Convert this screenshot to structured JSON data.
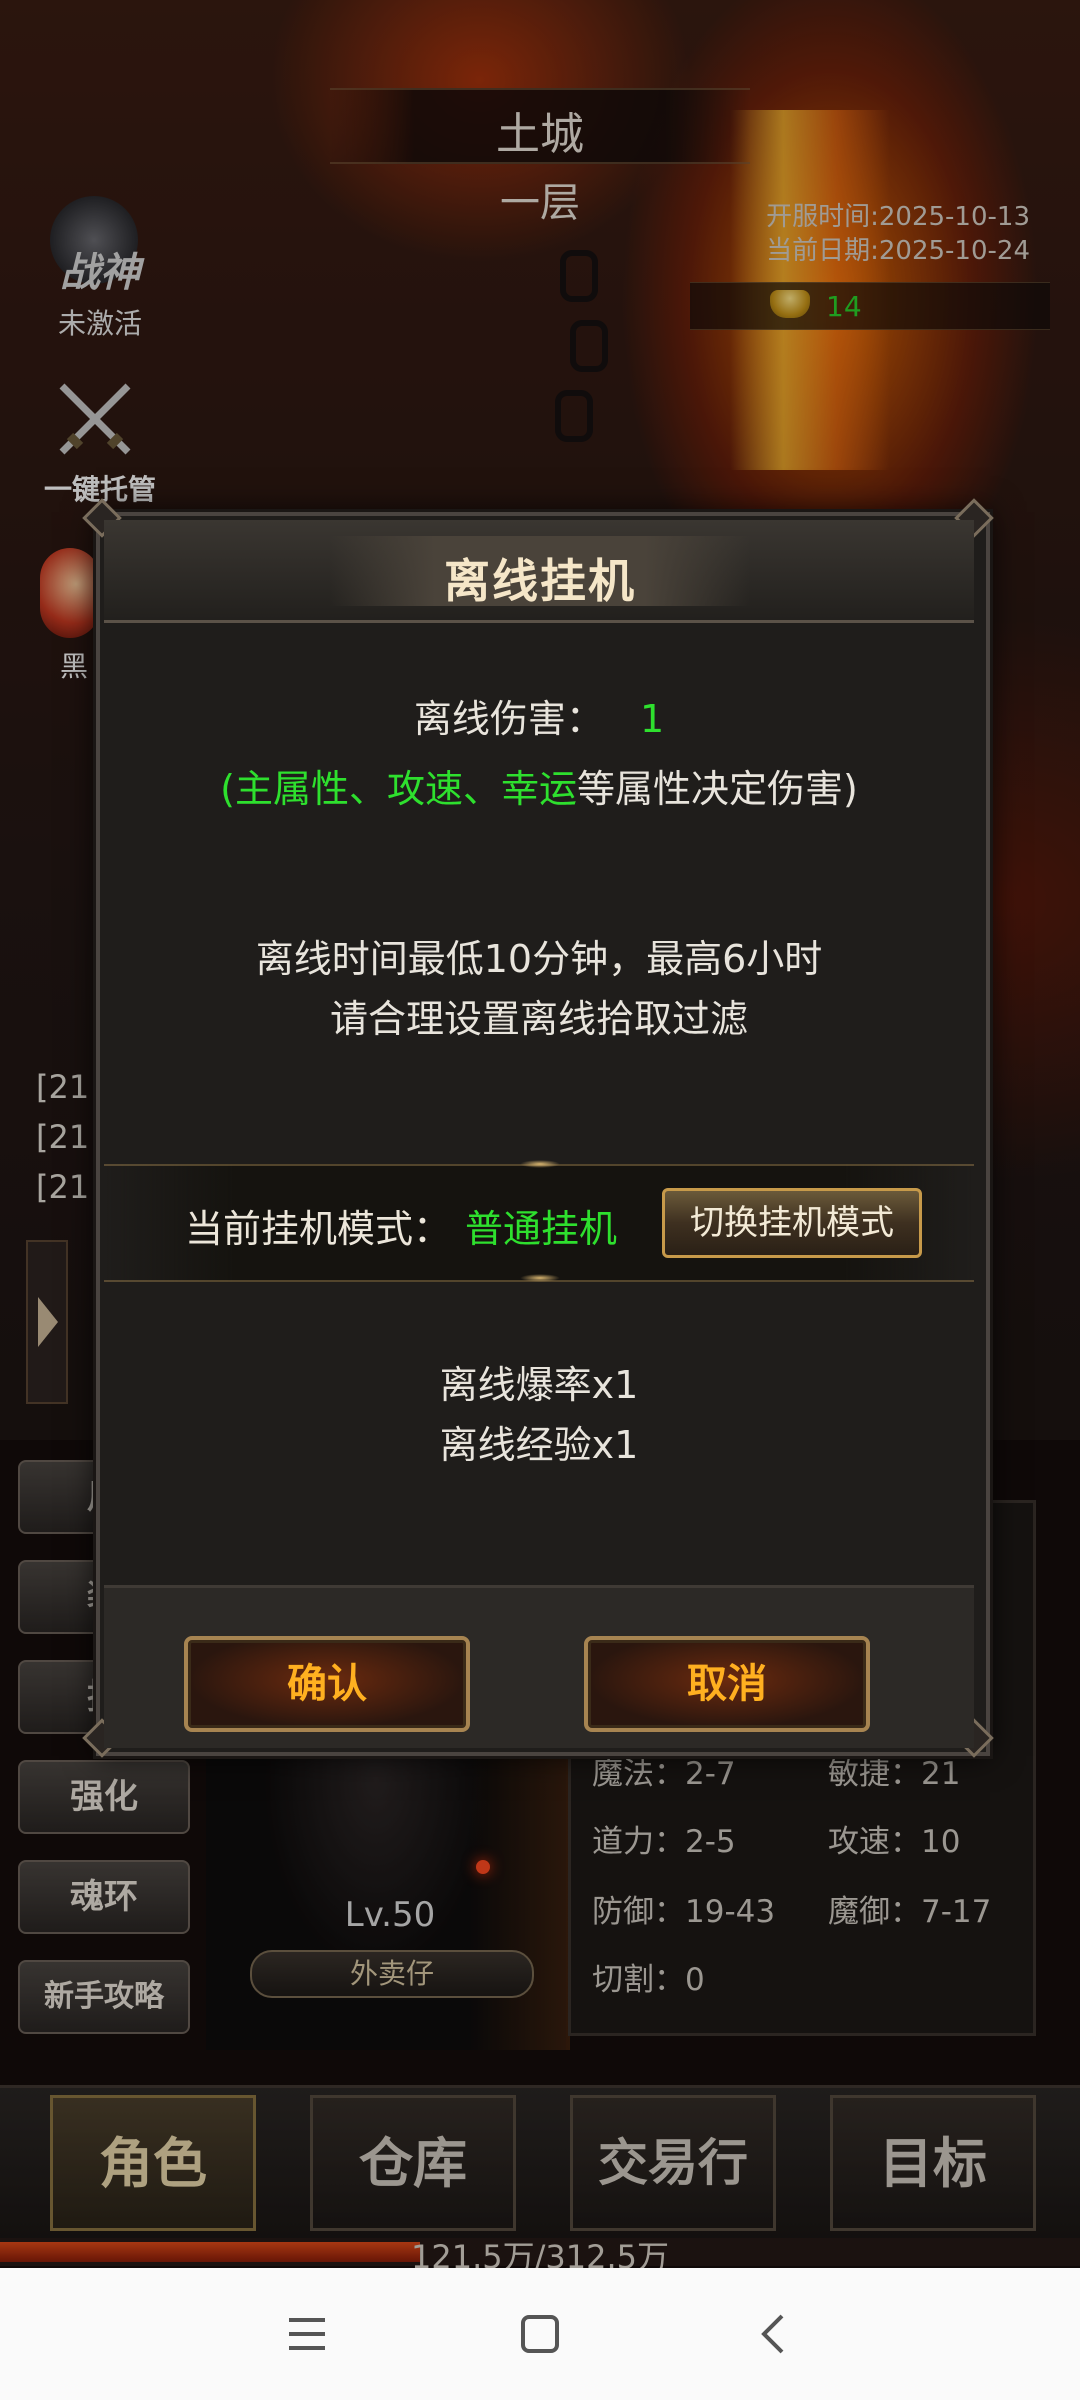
{
  "hud": {
    "map_name": "土城",
    "map_floor": "一层",
    "server_open": "开服时间:2025-10-13",
    "current_date": "当前日期:2025-10-24",
    "ingot_count": "14"
  },
  "side": {
    "wargod_badge": "战神",
    "wargod_status": "未激活",
    "auto_host": "一键托管",
    "black_label": "黑"
  },
  "chat": [
    "[21:",
    "[21:",
    "[21:"
  ],
  "left_menu": [
    "用",
    "装",
    "技",
    "强化",
    "魂环",
    "新手攻略"
  ],
  "character": {
    "level": "Lv.50",
    "name": "外卖仔",
    "stats": [
      {
        "label": "魔法：",
        "value": "2-7"
      },
      {
        "label": "敏捷：",
        "value": "21"
      },
      {
        "label": "道力：",
        "value": "2-5"
      },
      {
        "label": "攻速：",
        "value": "10"
      },
      {
        "label": "防御：",
        "value": "19-43"
      },
      {
        "label": "魔御：",
        "value": "7-17"
      },
      {
        "label": "切割：",
        "value": "0"
      }
    ]
  },
  "bottom_nav": [
    "角色",
    "仓库",
    "交易行",
    "目标"
  ],
  "exp": {
    "text": "121.5万/312.5万",
    "fraction": 0.389
  },
  "dialog": {
    "title": "离线挂机",
    "damage_label": "离线伤害：",
    "damage_value": "1",
    "damage_note_green": "(主属性、攻速、幸运",
    "damage_note_rest": "等属性决定伤害)",
    "time_note": "离线时间最低10分钟，最高6小时",
    "filter_note": "请合理设置离线拾取过滤",
    "mode_label": "当前挂机模式：",
    "mode_value": "普通挂机",
    "switch_button": "切换挂机模式",
    "drop_rate": "离线爆率x1",
    "exp_rate": "离线经验x1",
    "confirm": "确认",
    "cancel": "取消"
  },
  "colors": {
    "green": "#2ee02e",
    "gold": "#ffb020"
  }
}
